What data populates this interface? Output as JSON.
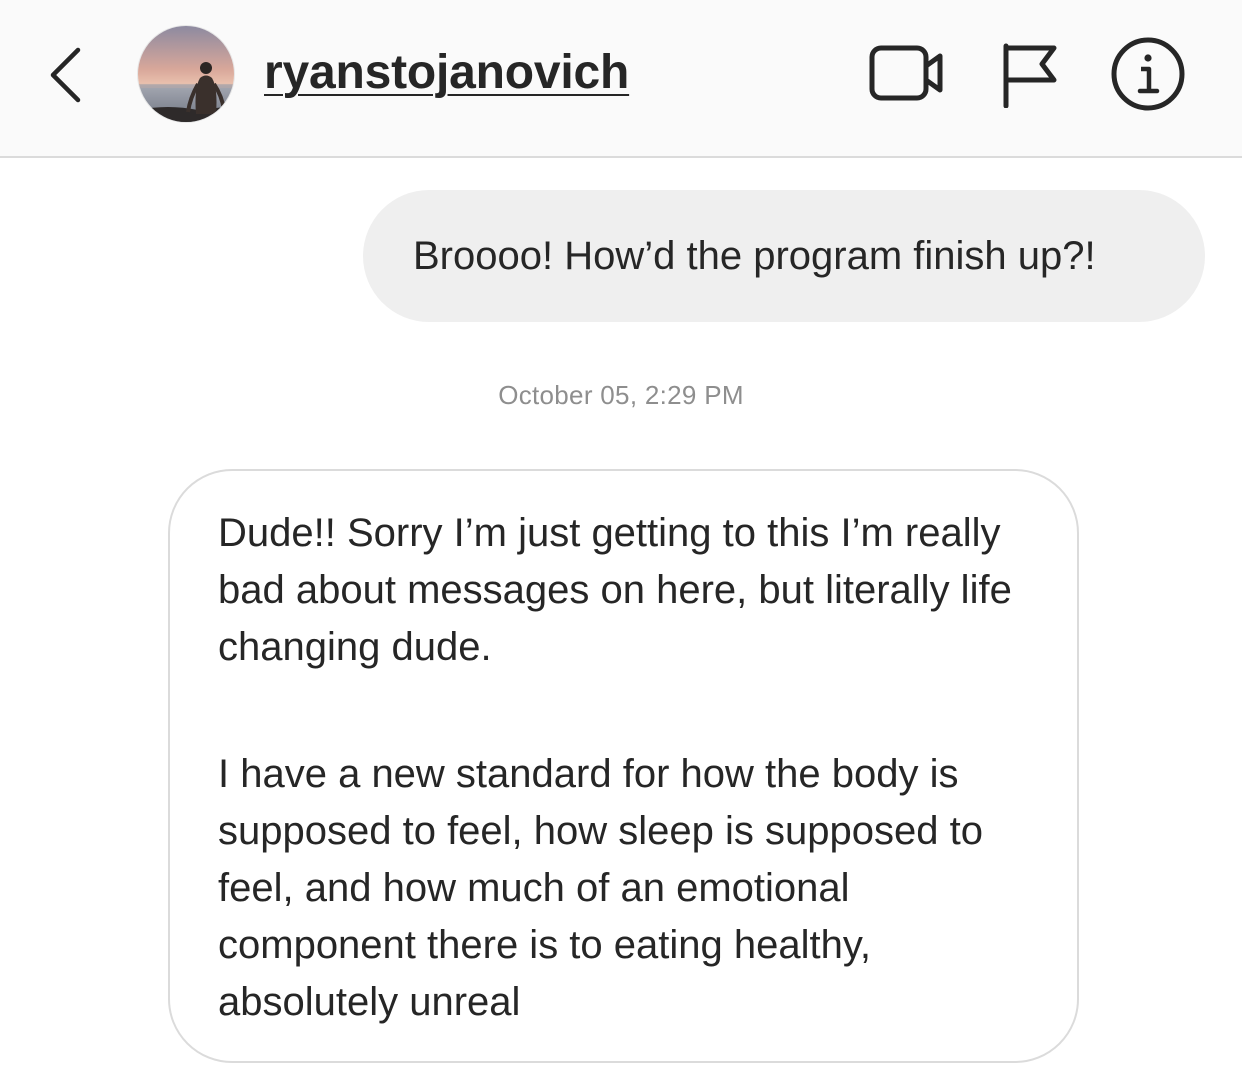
{
  "header": {
    "username": "ryanstojanovich",
    "back_icon": "chevron-left-icon",
    "actions": [
      {
        "name": "video-call",
        "icon": "video-camera-icon"
      },
      {
        "name": "report",
        "icon": "flag-icon"
      },
      {
        "name": "details",
        "icon": "info-icon"
      }
    ]
  },
  "thread": {
    "outgoing_message": "Broooo! How’d the program finish up?!",
    "timestamp": "October 05, 2:29 PM",
    "incoming_message": {
      "paragraph_1": "Dude!! Sorry I’m just getting to this I’m really bad about messages on here, but literally life changing dude.",
      "paragraph_2": "I have a new standard for how the body is supposed to feel, how sleep is supposed to feel, and how much of an emotional component there is to eating healthy, absolutely unreal"
    }
  },
  "colors": {
    "header_bg": "#fafafa",
    "divider": "#dbdbdb",
    "outgoing_bubble": "#efefef",
    "incoming_border": "#dbdbdb",
    "text": "#262626",
    "timestamp": "#8e8e8e"
  }
}
